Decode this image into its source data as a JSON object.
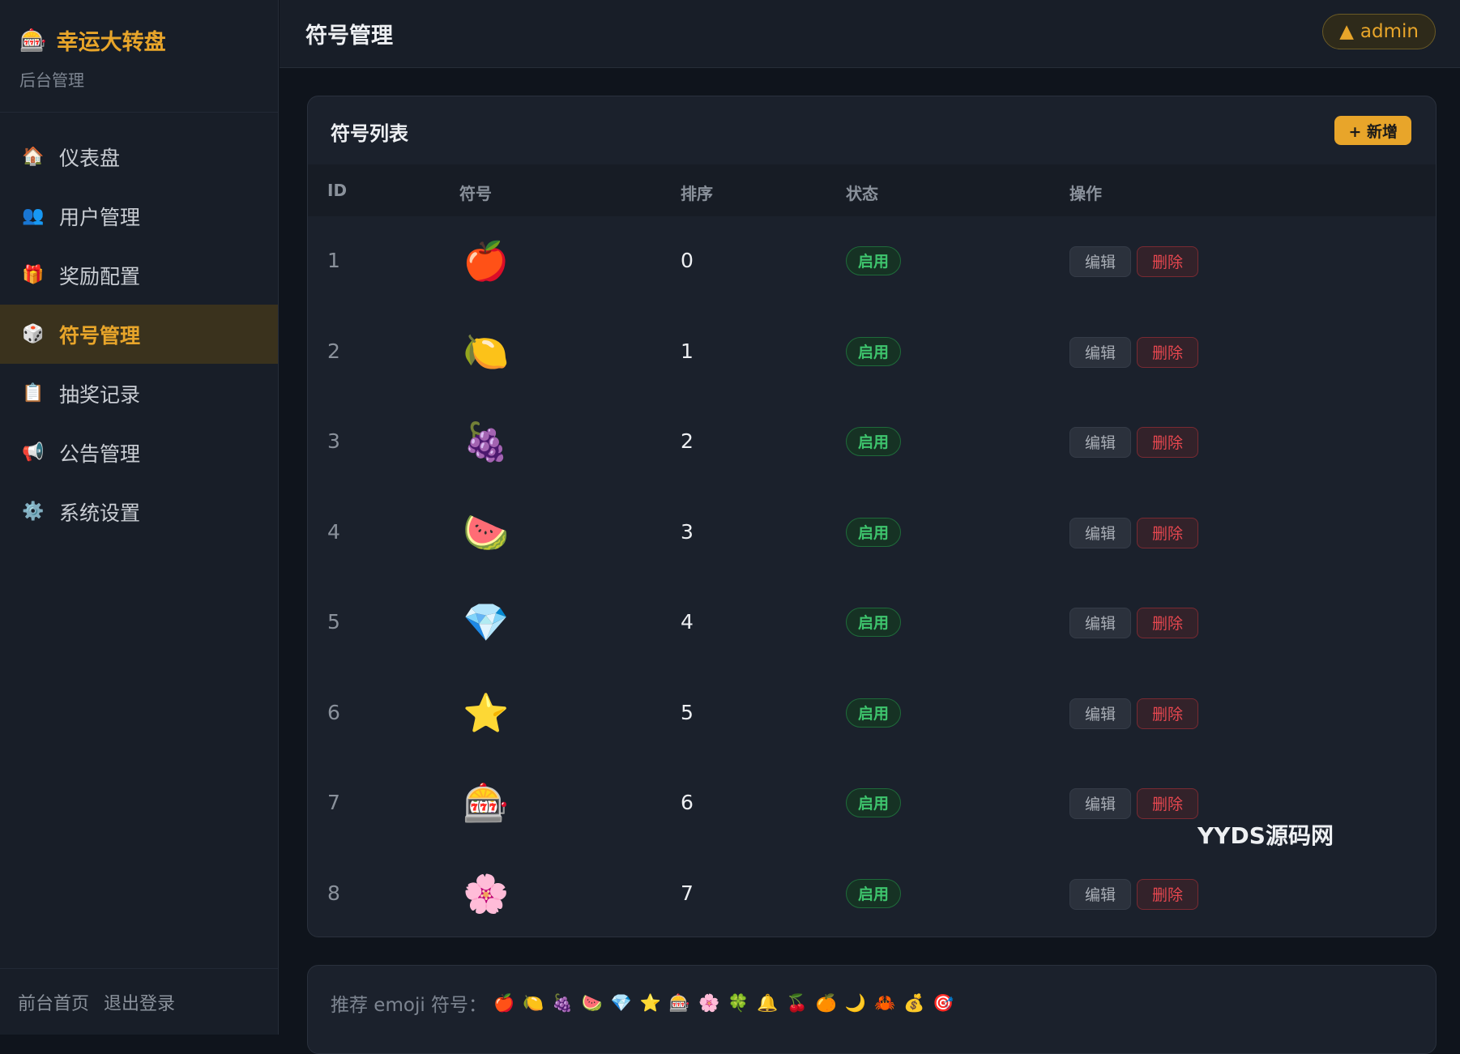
{
  "sidebar": {
    "brand_icon": "🎰",
    "brand_title": "幸运大转盘",
    "brand_subtitle": "后台管理",
    "items": [
      {
        "icon": "🏠",
        "label": "仪表盘"
      },
      {
        "icon": "👥",
        "label": "用户管理"
      },
      {
        "icon": "🎁",
        "label": "奖励配置"
      },
      {
        "icon": "🎲",
        "label": "符号管理"
      },
      {
        "icon": "📋",
        "label": "抽奖记录"
      },
      {
        "icon": "📢",
        "label": "公告管理"
      },
      {
        "icon": "⚙️",
        "label": "系统设置"
      }
    ],
    "footer": {
      "home": "前台首页",
      "logout": "退出登录"
    }
  },
  "header": {
    "title": "符号管理",
    "user_icon": "▲",
    "user": "admin"
  },
  "main": {
    "card_title": "符号列表",
    "add_button": "+ 新增",
    "columns": [
      "ID",
      "符号",
      "排序",
      "状态",
      "操作"
    ],
    "rows": [
      {
        "id": "1",
        "symbol": "🍎",
        "order": "0",
        "status": "启用",
        "edit": "编辑",
        "delete": "删除"
      },
      {
        "id": "2",
        "symbol": "🍋",
        "order": "1",
        "status": "启用",
        "edit": "编辑",
        "delete": "删除"
      },
      {
        "id": "3",
        "symbol": "🍇",
        "order": "2",
        "status": "启用",
        "edit": "编辑",
        "delete": "删除"
      },
      {
        "id": "4",
        "symbol": "🍉",
        "order": "3",
        "status": "启用",
        "edit": "编辑",
        "delete": "删除"
      },
      {
        "id": "5",
        "symbol": "💎",
        "order": "4",
        "status": "启用",
        "edit": "编辑",
        "delete": "删除"
      },
      {
        "id": "6",
        "symbol": "⭐",
        "order": "5",
        "status": "启用",
        "edit": "编辑",
        "delete": "删除"
      },
      {
        "id": "7",
        "symbol": "🎰",
        "order": "6",
        "status": "启用",
        "edit": "编辑",
        "delete": "删除"
      },
      {
        "id": "8",
        "symbol": "🌸",
        "order": "7",
        "status": "启用",
        "edit": "编辑",
        "delete": "删除"
      }
    ],
    "hint_label": "推荐 emoji 符号：",
    "hint_emojis": "🍎🍋🍇🍉💎⭐🎰🌸🍀🔔🍒🍊🌙🦀💰🎯"
  },
  "watermark": "YYDS源码网"
}
